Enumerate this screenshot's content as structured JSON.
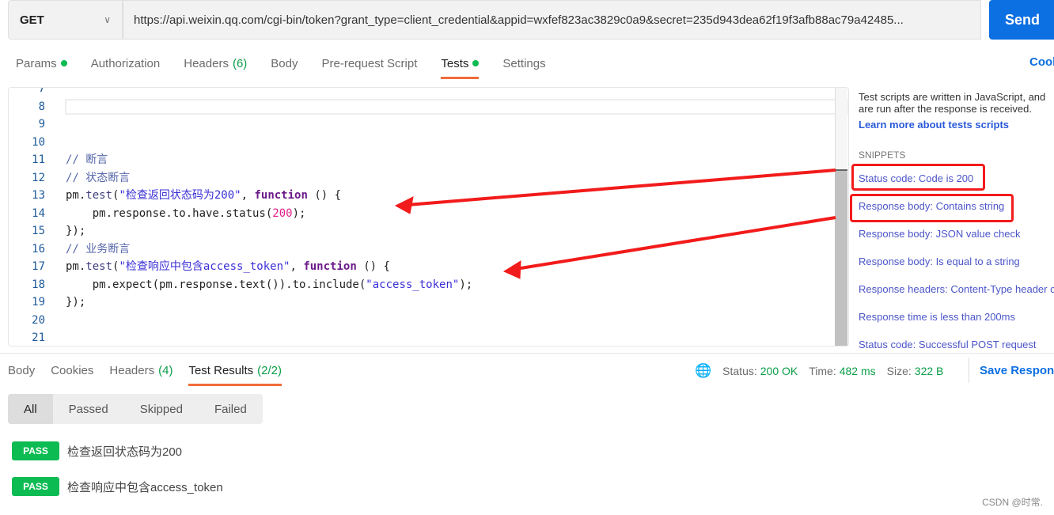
{
  "request": {
    "method": "GET",
    "url": "https://api.weixin.qq.com/cgi-bin/token?grant_type=client_credential&appid=wxfef823ac3829c0a9&secret=235d943dea62f19f3afb88ac79a42485...",
    "send": "Send"
  },
  "req_tabs": [
    {
      "label": "Params",
      "dot": true
    },
    {
      "label": "Authorization"
    },
    {
      "label": "Headers",
      "count": "(6)"
    },
    {
      "label": "Body"
    },
    {
      "label": "Pre-request Script"
    },
    {
      "label": "Tests",
      "dot": true,
      "active": true
    },
    {
      "label": "Settings"
    }
  ],
  "cookies": "Cookies",
  "editor": {
    "lines": [
      {
        "n": "7",
        "t": []
      },
      {
        "n": "8",
        "t": []
      },
      {
        "n": "9",
        "t": []
      },
      {
        "n": "10",
        "t": []
      },
      {
        "n": "11",
        "t": [
          [
            "// 断言",
            "cm"
          ]
        ]
      },
      {
        "n": "12",
        "t": [
          [
            "// 状态断言",
            "cm"
          ]
        ]
      },
      {
        "n": "13",
        "t": [
          [
            "pm.",
            "pl"
          ],
          [
            "test",
            "fn"
          ],
          [
            "(",
            "pl"
          ],
          [
            "\"检查返回状态码为200\"",
            "str"
          ],
          [
            ", ",
            "pl"
          ],
          [
            "function",
            "kw"
          ],
          [
            " () {",
            "pl"
          ]
        ]
      },
      {
        "n": "14",
        "t": [
          [
            "    pm.response.to.have.status(",
            "pl"
          ],
          [
            "200",
            "num"
          ],
          [
            ");",
            "pl"
          ]
        ]
      },
      {
        "n": "15",
        "t": [
          [
            "});",
            "pl"
          ]
        ]
      },
      {
        "n": "16",
        "t": [
          [
            "// 业务断言",
            "cm"
          ]
        ]
      },
      {
        "n": "17",
        "t": [
          [
            "pm.",
            "pl"
          ],
          [
            "test",
            "fn"
          ],
          [
            "(",
            "pl"
          ],
          [
            "\"检查响应中包含access_token\"",
            "str"
          ],
          [
            ", ",
            "pl"
          ],
          [
            "function",
            "kw"
          ],
          [
            " () {",
            "pl"
          ]
        ]
      },
      {
        "n": "18",
        "t": [
          [
            "    pm.expect(pm.response.text()).to.include(",
            "pl"
          ],
          [
            "\"access_token\"",
            "str"
          ],
          [
            ");",
            "pl"
          ]
        ]
      },
      {
        "n": "19",
        "t": [
          [
            "});",
            "pl"
          ]
        ]
      },
      {
        "n": "20",
        "t": []
      },
      {
        "n": "21",
        "t": []
      }
    ]
  },
  "side": {
    "desc": "Test scripts are written in JavaScript, and are run after the response is received.",
    "learn": "Learn more about tests scripts",
    "snippets_title": "SNIPPETS",
    "snippets": [
      "Status code: Code is 200",
      "Response body: Contains string",
      "Response body: JSON value check",
      "Response body: Is equal to a string",
      "Response headers: Content-Type header check",
      "Response time is less than 200ms",
      "Status code: Successful POST request"
    ]
  },
  "res_tabs": [
    {
      "label": "Body"
    },
    {
      "label": "Cookies"
    },
    {
      "label": "Headers",
      "count": "(4)"
    },
    {
      "label": "Test Results",
      "count": "(2/2)",
      "active": true
    }
  ],
  "meta": {
    "status_label": "Status:",
    "status": "200 OK",
    "time_label": "Time:",
    "time": "482 ms",
    "size_label": "Size:",
    "size": "322 B",
    "save": "Save Response"
  },
  "filters": [
    "All",
    "Passed",
    "Skipped",
    "Failed"
  ],
  "results": [
    {
      "badge": "PASS",
      "name": "检查返回状态码为200"
    },
    {
      "badge": "PASS",
      "name": "检查响应中包含access_token"
    }
  ],
  "watermark": "CSDN @时常.",
  "colors": {
    "accent": "#0c6fe2",
    "pass": "#0cbb52",
    "tab_underline": "#f26b3a",
    "annotation": "#f21b1b"
  }
}
